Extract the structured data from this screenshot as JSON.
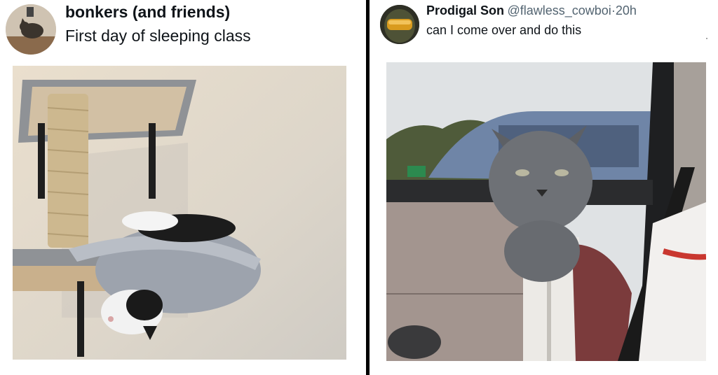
{
  "tweets": [
    {
      "display_name": "bonkers (and friends)",
      "handle": "",
      "time": "",
      "text": "First day of sleeping class",
      "avatar_icon": "cat-avatar-icon",
      "media_description_icon": "cat-tree-photo-icon"
    },
    {
      "display_name": "Prodigal Son",
      "handle": "@flawless_cowboi",
      "separator": "·",
      "time": "20h",
      "text": "can I come over and do this",
      "avatar_icon": "helmet-avatar-icon",
      "media_description_icon": "cat-in-car-photo-icon"
    }
  ],
  "colors": {
    "divider": "#000000",
    "text_primary": "#0f1419",
    "text_secondary": "#536471",
    "wall": "#d8d3ca",
    "cat_grey": "#6e7176"
  }
}
